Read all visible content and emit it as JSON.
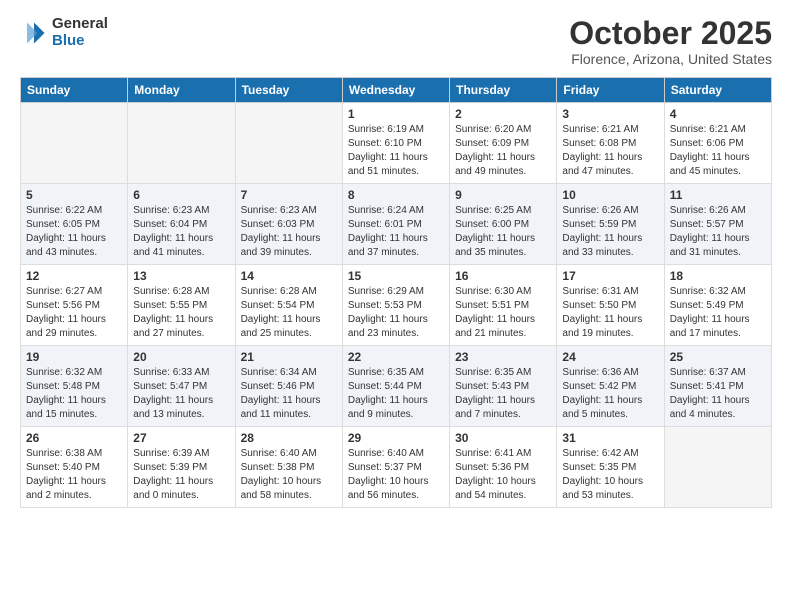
{
  "logo": {
    "general": "General",
    "blue": "Blue",
    "icon": "▶"
  },
  "title": {
    "month": "October 2025",
    "location": "Florence, Arizona, United States"
  },
  "weekdays": [
    "Sunday",
    "Monday",
    "Tuesday",
    "Wednesday",
    "Thursday",
    "Friday",
    "Saturday"
  ],
  "weeks": [
    [
      {
        "day": "",
        "sunrise": "",
        "sunset": "",
        "daylight": "",
        "empty": true
      },
      {
        "day": "",
        "sunrise": "",
        "sunset": "",
        "daylight": "",
        "empty": true
      },
      {
        "day": "",
        "sunrise": "",
        "sunset": "",
        "daylight": "",
        "empty": true
      },
      {
        "day": "1",
        "sunrise": "Sunrise: 6:19 AM",
        "sunset": "Sunset: 6:10 PM",
        "daylight": "Daylight: 11 hours and 51 minutes.",
        "empty": false
      },
      {
        "day": "2",
        "sunrise": "Sunrise: 6:20 AM",
        "sunset": "Sunset: 6:09 PM",
        "daylight": "Daylight: 11 hours and 49 minutes.",
        "empty": false
      },
      {
        "day": "3",
        "sunrise": "Sunrise: 6:21 AM",
        "sunset": "Sunset: 6:08 PM",
        "daylight": "Daylight: 11 hours and 47 minutes.",
        "empty": false
      },
      {
        "day": "4",
        "sunrise": "Sunrise: 6:21 AM",
        "sunset": "Sunset: 6:06 PM",
        "daylight": "Daylight: 11 hours and 45 minutes.",
        "empty": false
      }
    ],
    [
      {
        "day": "5",
        "sunrise": "Sunrise: 6:22 AM",
        "sunset": "Sunset: 6:05 PM",
        "daylight": "Daylight: 11 hours and 43 minutes.",
        "empty": false
      },
      {
        "day": "6",
        "sunrise": "Sunrise: 6:23 AM",
        "sunset": "Sunset: 6:04 PM",
        "daylight": "Daylight: 11 hours and 41 minutes.",
        "empty": false
      },
      {
        "day": "7",
        "sunrise": "Sunrise: 6:23 AM",
        "sunset": "Sunset: 6:03 PM",
        "daylight": "Daylight: 11 hours and 39 minutes.",
        "empty": false
      },
      {
        "day": "8",
        "sunrise": "Sunrise: 6:24 AM",
        "sunset": "Sunset: 6:01 PM",
        "daylight": "Daylight: 11 hours and 37 minutes.",
        "empty": false
      },
      {
        "day": "9",
        "sunrise": "Sunrise: 6:25 AM",
        "sunset": "Sunset: 6:00 PM",
        "daylight": "Daylight: 11 hours and 35 minutes.",
        "empty": false
      },
      {
        "day": "10",
        "sunrise": "Sunrise: 6:26 AM",
        "sunset": "Sunset: 5:59 PM",
        "daylight": "Daylight: 11 hours and 33 minutes.",
        "empty": false
      },
      {
        "day": "11",
        "sunrise": "Sunrise: 6:26 AM",
        "sunset": "Sunset: 5:57 PM",
        "daylight": "Daylight: 11 hours and 31 minutes.",
        "empty": false
      }
    ],
    [
      {
        "day": "12",
        "sunrise": "Sunrise: 6:27 AM",
        "sunset": "Sunset: 5:56 PM",
        "daylight": "Daylight: 11 hours and 29 minutes.",
        "empty": false
      },
      {
        "day": "13",
        "sunrise": "Sunrise: 6:28 AM",
        "sunset": "Sunset: 5:55 PM",
        "daylight": "Daylight: 11 hours and 27 minutes.",
        "empty": false
      },
      {
        "day": "14",
        "sunrise": "Sunrise: 6:28 AM",
        "sunset": "Sunset: 5:54 PM",
        "daylight": "Daylight: 11 hours and 25 minutes.",
        "empty": false
      },
      {
        "day": "15",
        "sunrise": "Sunrise: 6:29 AM",
        "sunset": "Sunset: 5:53 PM",
        "daylight": "Daylight: 11 hours and 23 minutes.",
        "empty": false
      },
      {
        "day": "16",
        "sunrise": "Sunrise: 6:30 AM",
        "sunset": "Sunset: 5:51 PM",
        "daylight": "Daylight: 11 hours and 21 minutes.",
        "empty": false
      },
      {
        "day": "17",
        "sunrise": "Sunrise: 6:31 AM",
        "sunset": "Sunset: 5:50 PM",
        "daylight": "Daylight: 11 hours and 19 minutes.",
        "empty": false
      },
      {
        "day": "18",
        "sunrise": "Sunrise: 6:32 AM",
        "sunset": "Sunset: 5:49 PM",
        "daylight": "Daylight: 11 hours and 17 minutes.",
        "empty": false
      }
    ],
    [
      {
        "day": "19",
        "sunrise": "Sunrise: 6:32 AM",
        "sunset": "Sunset: 5:48 PM",
        "daylight": "Daylight: 11 hours and 15 minutes.",
        "empty": false
      },
      {
        "day": "20",
        "sunrise": "Sunrise: 6:33 AM",
        "sunset": "Sunset: 5:47 PM",
        "daylight": "Daylight: 11 hours and 13 minutes.",
        "empty": false
      },
      {
        "day": "21",
        "sunrise": "Sunrise: 6:34 AM",
        "sunset": "Sunset: 5:46 PM",
        "daylight": "Daylight: 11 hours and 11 minutes.",
        "empty": false
      },
      {
        "day": "22",
        "sunrise": "Sunrise: 6:35 AM",
        "sunset": "Sunset: 5:44 PM",
        "daylight": "Daylight: 11 hours and 9 minutes.",
        "empty": false
      },
      {
        "day": "23",
        "sunrise": "Sunrise: 6:35 AM",
        "sunset": "Sunset: 5:43 PM",
        "daylight": "Daylight: 11 hours and 7 minutes.",
        "empty": false
      },
      {
        "day": "24",
        "sunrise": "Sunrise: 6:36 AM",
        "sunset": "Sunset: 5:42 PM",
        "daylight": "Daylight: 11 hours and 5 minutes.",
        "empty": false
      },
      {
        "day": "25",
        "sunrise": "Sunrise: 6:37 AM",
        "sunset": "Sunset: 5:41 PM",
        "daylight": "Daylight: 11 hours and 4 minutes.",
        "empty": false
      }
    ],
    [
      {
        "day": "26",
        "sunrise": "Sunrise: 6:38 AM",
        "sunset": "Sunset: 5:40 PM",
        "daylight": "Daylight: 11 hours and 2 minutes.",
        "empty": false
      },
      {
        "day": "27",
        "sunrise": "Sunrise: 6:39 AM",
        "sunset": "Sunset: 5:39 PM",
        "daylight": "Daylight: 11 hours and 0 minutes.",
        "empty": false
      },
      {
        "day": "28",
        "sunrise": "Sunrise: 6:40 AM",
        "sunset": "Sunset: 5:38 PM",
        "daylight": "Daylight: 10 hours and 58 minutes.",
        "empty": false
      },
      {
        "day": "29",
        "sunrise": "Sunrise: 6:40 AM",
        "sunset": "Sunset: 5:37 PM",
        "daylight": "Daylight: 10 hours and 56 minutes.",
        "empty": false
      },
      {
        "day": "30",
        "sunrise": "Sunrise: 6:41 AM",
        "sunset": "Sunset: 5:36 PM",
        "daylight": "Daylight: 10 hours and 54 minutes.",
        "empty": false
      },
      {
        "day": "31",
        "sunrise": "Sunrise: 6:42 AM",
        "sunset": "Sunset: 5:35 PM",
        "daylight": "Daylight: 10 hours and 53 minutes.",
        "empty": false
      },
      {
        "day": "",
        "sunrise": "",
        "sunset": "",
        "daylight": "",
        "empty": true
      }
    ]
  ]
}
